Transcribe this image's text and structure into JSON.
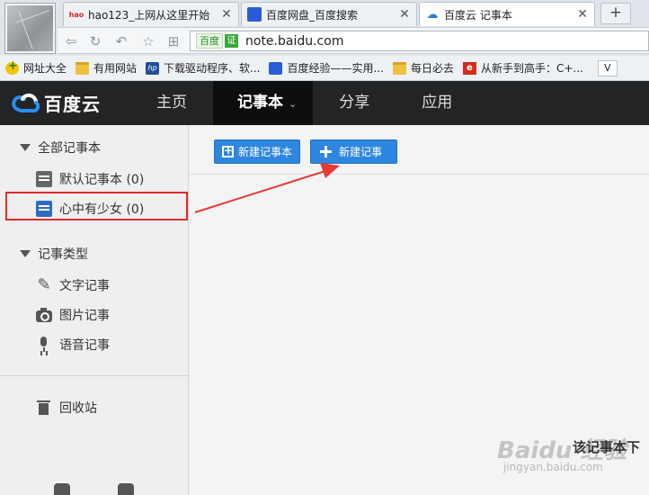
{
  "browser": {
    "tabs": [
      {
        "icon": "hao123-icon",
        "title": "hao123_上网从这里开始",
        "active": false
      },
      {
        "icon": "baidu-paw-icon",
        "title": "百度网盘_百度搜索",
        "active": false
      },
      {
        "icon": "baidu-cloud-icon",
        "title": "百度云 记事本",
        "active": true
      }
    ],
    "tab_close": "✕",
    "new_tab": "+",
    "site_badge": "百度",
    "cert_badge": "证",
    "url": "note.baidu.com",
    "bookmarks": [
      {
        "icon": "site-nav-icon",
        "label": "网址大全"
      },
      {
        "icon": "folder-icon",
        "label": "有用网站"
      },
      {
        "icon": "hp-icon",
        "label": "下载驱动程序、软..."
      },
      {
        "icon": "baidu-paw-icon",
        "label": "百度经验——实用..."
      },
      {
        "icon": "folder-icon",
        "label": "每日必去"
      },
      {
        "icon": "e-icon",
        "label": "从新手到高手：C+..."
      }
    ],
    "bookmark_overflow": "V"
  },
  "app": {
    "logo_text": "百度云",
    "nav": [
      {
        "label": "主页",
        "active": false
      },
      {
        "label": "记事本",
        "active": true,
        "caret": "⌄"
      },
      {
        "label": "分享",
        "active": false
      },
      {
        "label": "应用",
        "active": false
      }
    ]
  },
  "sidebar": {
    "notebooks_header": "全部记事本",
    "notebooks": [
      {
        "label": "默认记事本 (0)",
        "selected": false
      },
      {
        "label": "心中有少女 (0)",
        "selected": true
      }
    ],
    "types_header": "记事类型",
    "types": [
      {
        "icon": "pencil-icon",
        "label": "文字记事"
      },
      {
        "icon": "camera-icon",
        "label": "图片记事"
      },
      {
        "icon": "microphone-icon",
        "label": "语音记事"
      }
    ],
    "trash_label": "回收站"
  },
  "main": {
    "new_notebook_button": "新建记事本",
    "new_note_button": "新建记事",
    "empty_text": "该记事本下",
    "watermark": "Baidu 经验",
    "watermark_sub": "jingyan.baidu.com"
  },
  "colors": {
    "header_bg": "#222426",
    "button_blue": "#2f86df",
    "highlight_red": "#e02a2a"
  }
}
